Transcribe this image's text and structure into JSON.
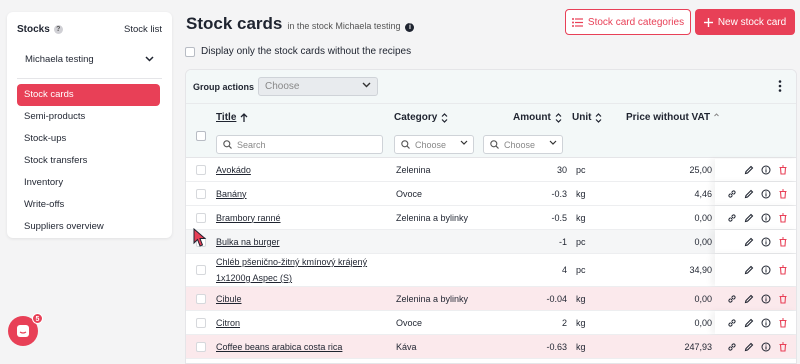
{
  "sidebar": {
    "title": "Stocks",
    "help_glyph": "?",
    "stock_list_link": "Stock list",
    "selected_stock": "Michaela testing",
    "items": [
      {
        "label": "Stock cards",
        "active": true
      },
      {
        "label": "Semi-products"
      },
      {
        "label": "Stock-ups"
      },
      {
        "label": "Stock transfers"
      },
      {
        "label": "Inventory"
      },
      {
        "label": "Write-offs"
      },
      {
        "label": "Suppliers overview"
      }
    ]
  },
  "chat": {
    "badge": "5"
  },
  "header": {
    "title": "Stock cards",
    "subtitle": "in the stock Michaela testing",
    "categories_button": "Stock card categories",
    "new_button": "New stock card"
  },
  "filter": {
    "label": "Display only the stock cards without the recipes"
  },
  "group_actions": {
    "label": "Group actions",
    "placeholder": "Choose"
  },
  "columns": {
    "title": "Title",
    "category": "Category",
    "amount": "Amount",
    "unit": "Unit",
    "price": "Price without VAT",
    "search_placeholder": "Search",
    "choose": "Choose"
  },
  "rows": [
    {
      "title": "Avokádo",
      "category": "Zelenina",
      "amount": "30",
      "unit": "pc",
      "price": "25,00"
    },
    {
      "title": "Banány",
      "category": "Ovoce",
      "amount": "-0.3",
      "unit": "kg",
      "price": "4,46"
    },
    {
      "title": "Brambory ranné",
      "category": "Zelenina a bylinky",
      "amount": "-0.5",
      "unit": "kg",
      "price": "0,00"
    },
    {
      "title": "Bulka na burger",
      "category": "",
      "amount": "-1",
      "unit": "pc",
      "price": "0,00"
    },
    {
      "title": "Chléb pšenično-žitný kmínový krájený 1x1200g Aspec (S)",
      "category": "",
      "amount": "4",
      "unit": "pc",
      "price": "34,90"
    },
    {
      "title": "Cibule",
      "category": "Zelenina a bylinky",
      "amount": "-0.04",
      "unit": "kg",
      "price": "0,00"
    },
    {
      "title": "Citron",
      "category": "Ovoce",
      "amount": "2",
      "unit": "kg",
      "price": "0,00"
    },
    {
      "title": "Coffee beans arabica costa rica",
      "category": "Káva",
      "amount": "-0.63",
      "unit": "kg",
      "price": "247,93"
    }
  ],
  "colors": {
    "accent": "#e84057",
    "row_negative": "#fbe9ec"
  }
}
